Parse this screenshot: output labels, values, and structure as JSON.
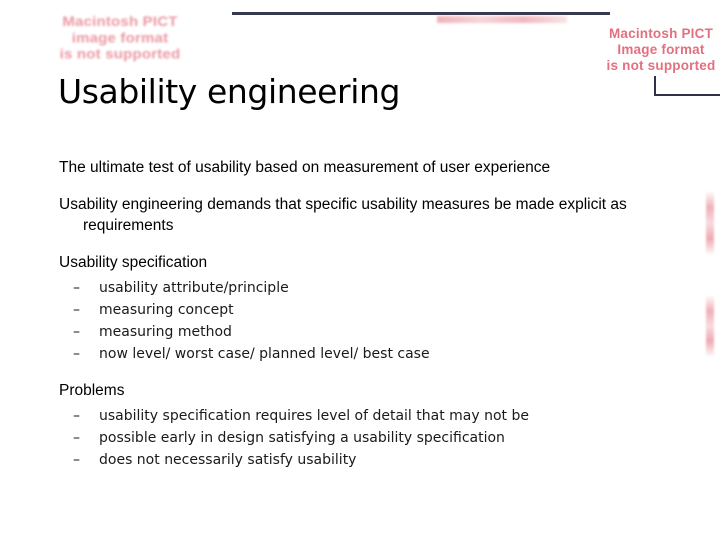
{
  "slide": {
    "title": "Usability engineering",
    "paragraphs": [
      "The ultimate test of usability based on measurement of user experience",
      "Usability engineering demands that specific usability measures be made explicit as requirements"
    ],
    "sections": [
      {
        "heading": "Usability specification",
        "items": [
          "usability attribute/principle",
          "measuring concept",
          "measuring method",
          "now level/ worst case/ planned level/ best case"
        ]
      },
      {
        "heading": "Problems",
        "items": [
          "usability specification requires level of detail that may not be",
          "possible early in design satisfying a usability specification",
          "does not necessarily satisfy usability"
        ]
      }
    ],
    "bullet_dash": "–"
  },
  "placeholders": {
    "left_notice": "Macintosh PICT\nimage format\nis not supported",
    "right_notice": "Macintosh PICT\nImage format\nis not supported"
  },
  "colors": {
    "rule": "#353a50",
    "placeholder_text": "#e3707f",
    "body_text": "#000000"
  }
}
